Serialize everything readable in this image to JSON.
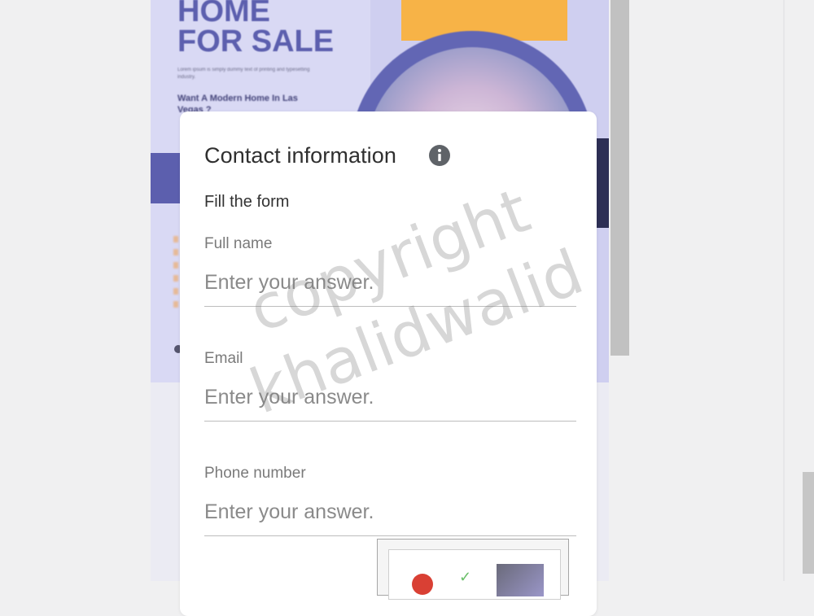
{
  "flyer": {
    "title_line1": "HOME",
    "title_line2": "FOR SALE",
    "small_text": "Lorem ipsum is simply dummy text of printing and typesetting industry.",
    "subtitle": "Want A Modern Home In Las Vegas ?"
  },
  "form": {
    "title": "Contact information",
    "info_icon": "info-icon",
    "subtitle": "Fill the form",
    "fields": [
      {
        "label": "Full name",
        "placeholder": "Enter your answer."
      },
      {
        "label": "Email",
        "placeholder": "Enter your answer."
      },
      {
        "label": "Phone number",
        "placeholder": "Enter your answer."
      }
    ]
  },
  "watermark": {
    "line1": "copyright",
    "line2": "khalidwalid"
  },
  "colors": {
    "accent": "#5c5fae",
    "flyer_bg": "#d9d9f4",
    "orange": "#f7b347",
    "info_icon": "#5f6368"
  }
}
